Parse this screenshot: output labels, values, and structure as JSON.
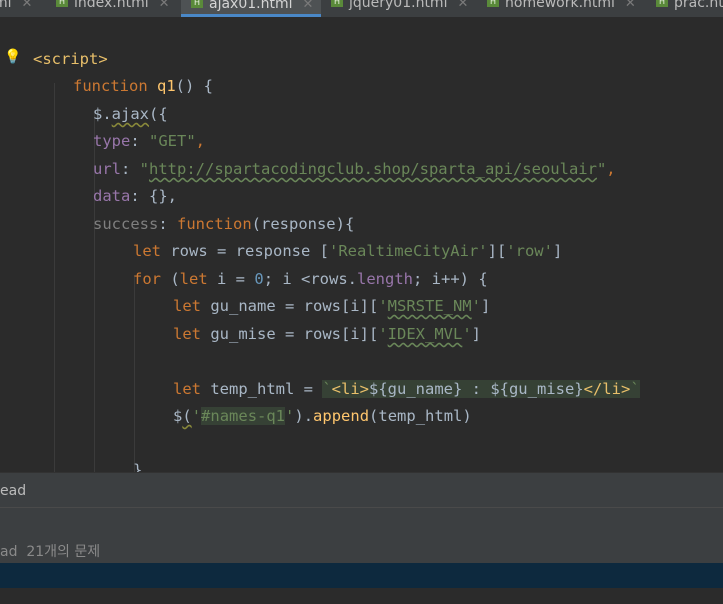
{
  "tabs": [
    {
      "label": "ml",
      "active": false
    },
    {
      "label": "index.html",
      "active": false
    },
    {
      "label": "ajax01.html",
      "active": true
    },
    {
      "label": "jquery01.html",
      "active": false
    },
    {
      "label": "homework.html",
      "active": false
    },
    {
      "label": "prac.ht",
      "active": false
    }
  ],
  "code": {
    "script_open": "<script>",
    "function_kw": "function",
    "q1_name": "q1",
    "q1_rest": "() {",
    "dollar": "$.",
    "ajax": "ajax",
    "ajax_rest": "({",
    "type_key": "type",
    "type_colon": ": ",
    "type_val": "\"GET\"",
    "comma": ",",
    "url_key": "url",
    "url_colon": ": ",
    "url_q1": "\"",
    "url_val": "http://spartacodingclub.shop/sparta_api/seoulair",
    "url_q2": "\"",
    "data_key": "data",
    "data_val": ": {},",
    "success_key": "success",
    "success_colon": ": ",
    "success_fn": "function",
    "success_rest": "(response){",
    "let1": "let",
    "rows_assign": " rows = response [",
    "realtime": "'RealtimeCityAir'",
    "br1": "][",
    "row_str": "'row'",
    "br1_end": "]",
    "for_kw": "for",
    "for_p1": " (",
    "for_let": "let",
    "for_p2": " i = ",
    "zero": "0",
    "for_p3": "; i <rows.",
    "length": "length",
    "for_p4": "; i++) {",
    "let2": "let",
    "gu_assign": " gu_name = rows[i][",
    "msrste_q1": "'",
    "msrste": "MSRSTE_NM",
    "msrste_q2": "'",
    "gu_end": "]",
    "let3": "let",
    "mise_assign": " gu_mise = rows[i][",
    "idex_q1": "'",
    "idex": "IDEX_MVL",
    "idex_q2": "'",
    "mise_end": "]",
    "let4": "let",
    "temp_assign": " temp_html = ",
    "bt1": "`",
    "li_open": "<li>",
    "tpl_mid": "${gu_name} : ${gu_mise}",
    "li_close": "</li>",
    "bt2": "`",
    "dollar2": "$",
    "paren_open": "(",
    "names_q1": "'",
    "names_sel": "#names-q1",
    "names_q2": "'",
    "paren_close": ").",
    "append": "append",
    "append_rest": "(temp_html)",
    "closing_brace": "}"
  },
  "panel": {
    "head_label": "ead",
    "problems_label": "ad  21개의 문제"
  },
  "colors": {
    "background": "#2b2b2b",
    "keyword": "#cc7832",
    "string": "#6a8759",
    "property": "#9876aa",
    "function": "#ffc66d",
    "statusbar": "#0d293e"
  },
  "icons": {
    "tab_file": "html-file-icon",
    "tab_close": "close-icon",
    "intention": "lightbulb-icon"
  }
}
